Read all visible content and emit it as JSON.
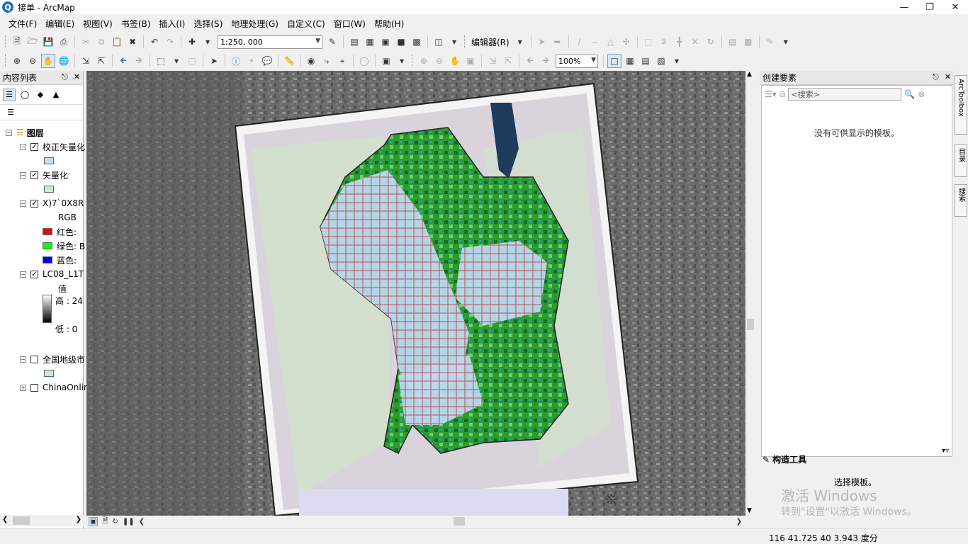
{
  "window": {
    "title": "接单 - ArcMap",
    "app_icon_glyph": "Q"
  },
  "menu": [
    "文件(F)",
    "编辑(E)",
    "视图(V)",
    "书签(B)",
    "插入(I)",
    "选择(S)",
    "地理处理(G)",
    "自定义(C)",
    "窗口(W)",
    "帮助(H)"
  ],
  "toolbar": {
    "scale": "1:250, 000",
    "editor_label": "编辑器(R)",
    "zoom": "100%"
  },
  "toc": {
    "title": "内容列表",
    "group_label": "图层",
    "layers": [
      {
        "name": "校正矢量化",
        "checked": true,
        "swatch": "#c8def0"
      },
      {
        "name": "矢量化",
        "checked": true,
        "swatch": "#c8ecc8"
      },
      {
        "name": "X)7`0X8R",
        "checked": true,
        "rgb_label": "RGB",
        "bands": [
          {
            "label": "红色:",
            "color": "#ff0000"
          },
          {
            "label": "绿色: B",
            "color": "#00ff00"
          },
          {
            "label": "蓝色:",
            "color": "#0000ff"
          }
        ]
      },
      {
        "name": "LC08_L1T",
        "checked": true,
        "value_label": "值",
        "high": "高 : 24",
        "low": "低 : 0"
      },
      {
        "name": "全国地级市",
        "checked": false,
        "swatch": "#c8ecc8"
      },
      {
        "name": "ChinaOnline",
        "checked": false
      }
    ]
  },
  "right_panel": {
    "title": "创建要素",
    "search_placeholder": "<搜索>",
    "no_template": "没有可供显示的模板。",
    "construct_title": "构造工具",
    "select_template": "选择模板。",
    "watermark_line1": "激活 Windows",
    "watermark_line2": "转到\"设置\"以激活 Windows。"
  },
  "side_tabs": [
    "ArcToolbox",
    "目录",
    "搜索"
  ],
  "status": {
    "coordinates": "116 41.725  40 3.943  度分"
  }
}
